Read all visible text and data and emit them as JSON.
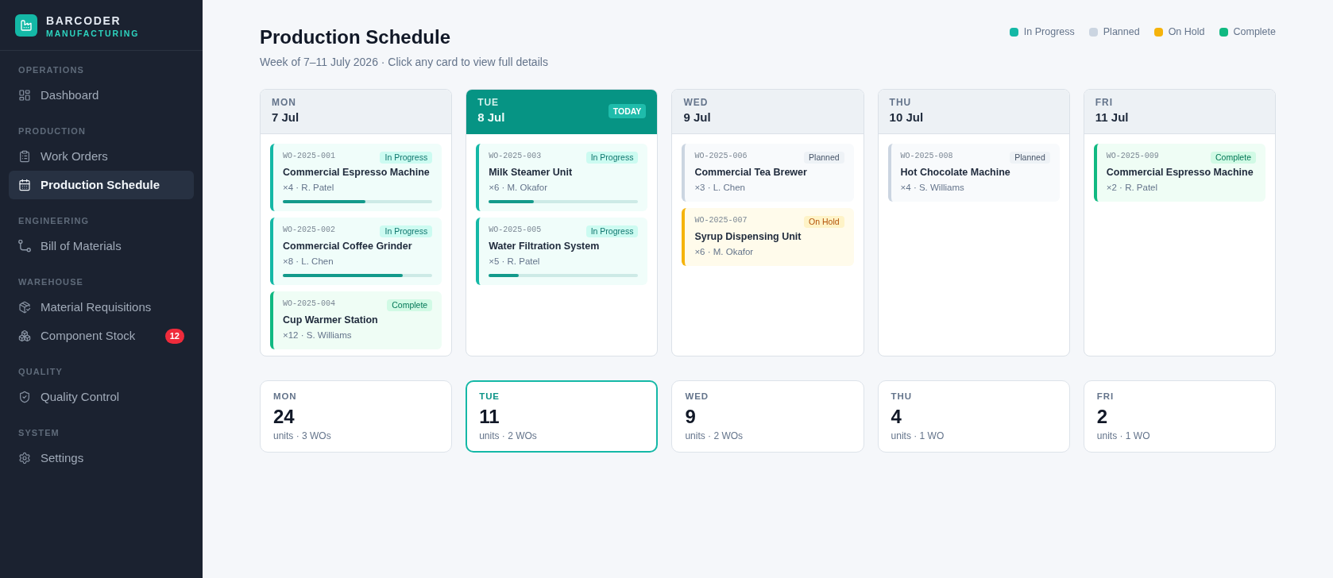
{
  "sidebar": {
    "brand": {
      "name": "BARCODER",
      "tagline": "MANUFACTURING"
    },
    "sections": [
      {
        "label": "OPERATIONS",
        "items": [
          {
            "label": "Dashboard",
            "selected": false
          }
        ]
      },
      {
        "label": "PRODUCTION",
        "items": [
          {
            "label": "Work Orders",
            "selected": false
          },
          {
            "label": "Production Schedule",
            "selected": true
          }
        ]
      },
      {
        "label": "ENGINEERING",
        "items": [
          {
            "label": "Bill of Materials",
            "selected": false
          }
        ]
      },
      {
        "label": "WAREHOUSE",
        "items": [
          {
            "label": "Material Requisitions",
            "selected": false
          },
          {
            "label": "Component Stock",
            "selected": false,
            "badge": "12"
          }
        ]
      },
      {
        "label": "QUALITY",
        "items": [
          {
            "label": "Quality Control",
            "selected": false
          }
        ]
      },
      {
        "label": "SYSTEM",
        "items": [
          {
            "label": "Settings",
            "selected": false
          }
        ]
      }
    ]
  },
  "header": {
    "title": "Production Schedule",
    "subtitle": "Week of 7–11 July 2026 · Click any card to view full details"
  },
  "legend": [
    {
      "label": "In Progress",
      "color": "#14b8a6"
    },
    {
      "label": "Planned",
      "color": "#cbd5e1"
    },
    {
      "label": "On Hold",
      "color": "#f5b30b"
    },
    {
      "label": "Complete",
      "color": "#10b981"
    }
  ],
  "days": [
    {
      "day": "MON",
      "date": "7 Jul",
      "today": false,
      "orders": [
        {
          "id": "WO-2025-001",
          "status": "In Progress",
          "kind": "in_progress",
          "title": "Commercial Espresso Machine",
          "meta": "×4 · R. Patel",
          "level": 0.55
        },
        {
          "id": "WO-2025-002",
          "status": "In Progress",
          "kind": "in_progress",
          "title": "Commercial Coffee Grinder",
          "meta": "×8 · L. Chen",
          "level": 0.8
        },
        {
          "id": "WO-2025-004",
          "status": "Complete",
          "kind": "complete",
          "title": "Cup Warmer Station",
          "meta": "×12 · S. Williams"
        }
      ]
    },
    {
      "day": "TUE",
      "date": "8 Jul",
      "today": true,
      "badge": "TODAY",
      "orders": [
        {
          "id": "WO-2025-003",
          "status": "In Progress",
          "kind": "in_progress",
          "title": "Milk Steamer Unit",
          "meta": "×6 · M. Okafor",
          "level": 0.3
        },
        {
          "id": "WO-2025-005",
          "status": "In Progress",
          "kind": "in_progress",
          "title": "Water Filtration System",
          "meta": "×5 · R. Patel",
          "level": 0.2
        }
      ]
    },
    {
      "day": "WED",
      "date": "9 Jul",
      "today": false,
      "orders": [
        {
          "id": "WO-2025-006",
          "status": "Planned",
          "kind": "planned",
          "title": "Commercial Tea Brewer",
          "meta": "×3 · L. Chen"
        },
        {
          "id": "WO-2025-007",
          "status": "On Hold",
          "kind": "on_hold",
          "title": "Syrup Dispensing Unit",
          "meta": "×6 · M. Okafor"
        }
      ]
    },
    {
      "day": "THU",
      "date": "10 Jul",
      "today": false,
      "orders": [
        {
          "id": "WO-2025-008",
          "status": "Planned",
          "kind": "planned",
          "title": "Hot Chocolate Machine",
          "meta": "×4 · S. Williams"
        }
      ]
    },
    {
      "day": "FRI",
      "date": "11 Jul",
      "today": false,
      "orders": [
        {
          "id": "WO-2025-009",
          "status": "Complete",
          "kind": "complete",
          "title": "Commercial Espresso Machine",
          "meta": "×2 · R. Patel"
        }
      ]
    }
  ],
  "summary": [
    {
      "day": "MON",
      "units": "24",
      "detail": "units · 3 WOs",
      "selected": false
    },
    {
      "day": "TUE",
      "units": "11",
      "detail": "units · 2 WOs",
      "selected": true
    },
    {
      "day": "WED",
      "units": "9",
      "detail": "units · 2 WOs",
      "selected": false
    },
    {
      "day": "THU",
      "units": "4",
      "detail": "units · 1 WO",
      "selected": false
    },
    {
      "day": "FRI",
      "units": "2",
      "detail": "units · 1 WO",
      "selected": false
    }
  ]
}
